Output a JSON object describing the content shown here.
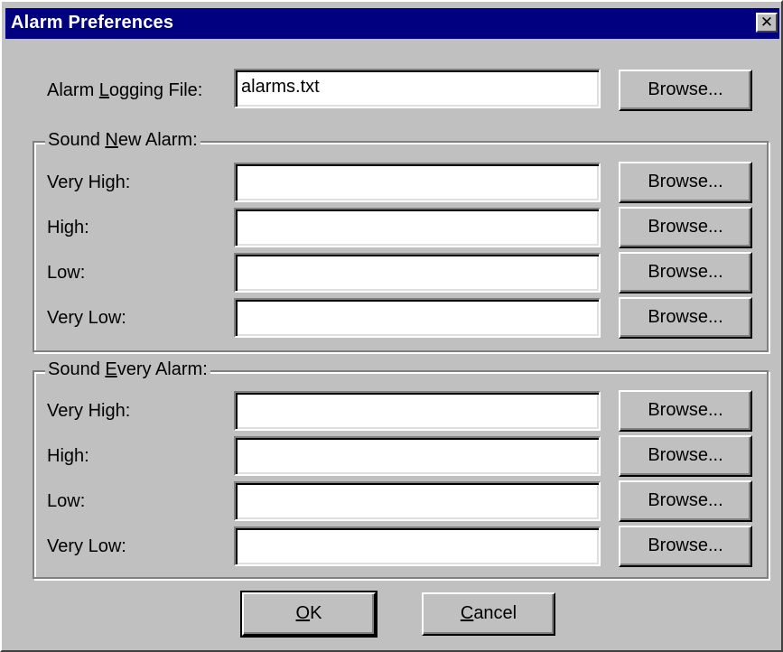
{
  "window": {
    "title": "Alarm Preferences",
    "close_glyph": "✕",
    "close_icon": "close-icon",
    "titlebar_color": "#000080",
    "face_color": "#c0c0c0"
  },
  "logging": {
    "label_prefix": "Alarm ",
    "label_accel": "L",
    "label_suffix": "ogging File:",
    "value": "alarms.txt",
    "browse_label": "Browse..."
  },
  "sound_new_alarm": {
    "legend_prefix": "Sound ",
    "legend_accel": "N",
    "legend_suffix": "ew Alarm:",
    "rows": [
      {
        "label": "Very High:",
        "value": "",
        "browse_label": "Browse..."
      },
      {
        "label": "High:",
        "value": "",
        "browse_label": "Browse..."
      },
      {
        "label": "Low:",
        "value": "",
        "browse_label": "Browse..."
      },
      {
        "label": "Very Low:",
        "value": "",
        "browse_label": "Browse..."
      }
    ]
  },
  "sound_every_alarm": {
    "legend_prefix": "Sound ",
    "legend_accel": "E",
    "legend_suffix": "very Alarm:",
    "rows": [
      {
        "label": "Very High:",
        "value": "",
        "browse_label": "Browse..."
      },
      {
        "label": "High:",
        "value": "",
        "browse_label": "Browse..."
      },
      {
        "label": "Low:",
        "value": "",
        "browse_label": "Browse..."
      },
      {
        "label": "Very Low:",
        "value": "",
        "browse_label": "Browse..."
      }
    ]
  },
  "buttons": {
    "ok_accel": "O",
    "ok_rest": "K",
    "cancel_accel": "C",
    "cancel_rest": "ancel"
  }
}
